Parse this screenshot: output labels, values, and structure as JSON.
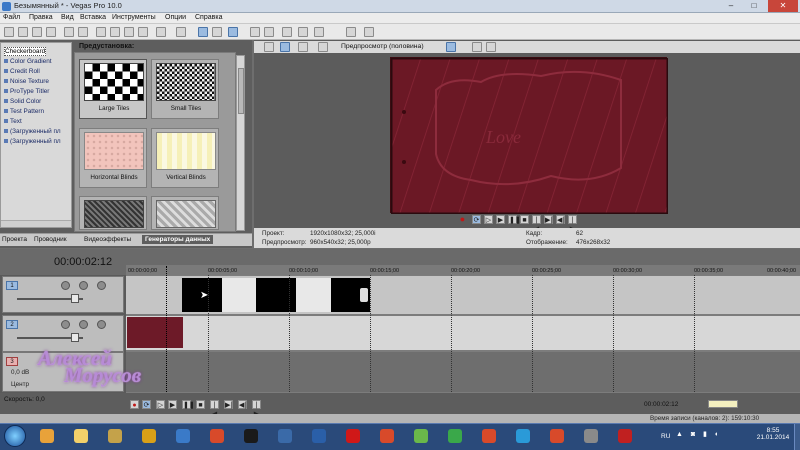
{
  "window": {
    "title": "Безымянный * - Vegas Pro 10.0",
    "min": "–",
    "max": "□",
    "close": "✕"
  },
  "menu": [
    "Файл",
    "Правка",
    "Вид",
    "Вставка",
    "Инструменты",
    "Опции",
    "Справка"
  ],
  "media_list": {
    "items": [
      "Checkerboard",
      "Color Gradient",
      "Credit Roll",
      "Noise Texture",
      "ProType Titler",
      "Solid Color",
      "Test Pattern",
      "Text",
      "(Загруженный пл",
      "(Загруженный пл"
    ],
    "selected": "Checkerboard"
  },
  "presets": {
    "label": "Предустановка:",
    "items": [
      "Large Tiles",
      "Small Tiles",
      "Horizontal Blinds",
      "Vertical Blinds",
      "",
      ""
    ],
    "selected": "Large Tiles"
  },
  "tabs": {
    "items": [
      "Проекта",
      "Проводник",
      "Видеоэффекты",
      "Генераторы данных"
    ],
    "active": "Генераторы данных"
  },
  "preview": {
    "mode": "Предпросмотр (половина)",
    "project_label": "Проект:",
    "project_value": "1920x1080x32; 25,000i",
    "preview_label": "Предпросмотр:",
    "preview_value": "960x540x32; 25,000p",
    "frame_label": "Кадр:",
    "frame_value": "62",
    "display_label": "Отображение:",
    "display_value": "476x268x32"
  },
  "timeline": {
    "timecode": "00:00:02:12",
    "ticks": [
      "00:00:00;00",
      "00:00:05;00",
      "00:00:10;00",
      "00:00:15;00",
      "00:00:20;00",
      "00:00:25;00",
      "00:00:30;00",
      "00:00:35;00",
      "00:00:40;00"
    ],
    "tracks": [
      {
        "num": "1"
      },
      {
        "num": "2"
      },
      {
        "num": "3",
        "volume": "0,0 dB",
        "pan": "Центр"
      }
    ],
    "end_timecode": "00:00:02:12",
    "speed": "Скорость: 0,0",
    "record_time": "Время записи (каналов: 2): 159:10:30"
  },
  "watermark": {
    "line1": "Алексей",
    "line2": "Морусов"
  },
  "taskbar": {
    "lang": "RU",
    "time": "8:55",
    "date": "21.01.2014",
    "apps": [
      "#e8a23a",
      "#f2d06a",
      "#c4a24a",
      "#d8a018",
      "#3a7ac8",
      "#d84a2a",
      "#1a1a1a",
      "#3a6aa8",
      "#2a5fa8",
      "#d01818",
      "#d84a2a",
      "#6ab84a",
      "#3aa84a",
      "#d84a2a",
      "#2a9ad8",
      "#d84a2a",
      "#8a8a8a",
      "#c02020"
    ]
  },
  "colors": {
    "accent": "#9bbbe0",
    "video_bg": "#6b1825",
    "taskbar": "#2a4a7a"
  }
}
